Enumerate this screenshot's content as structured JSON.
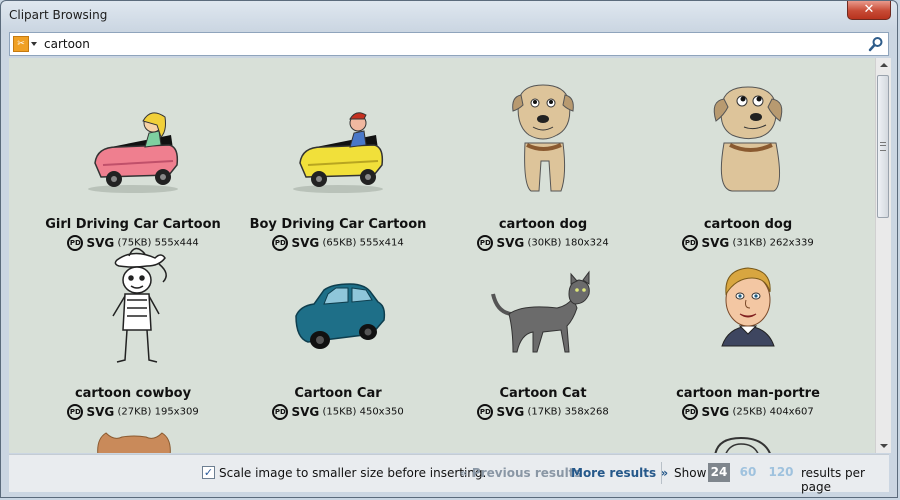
{
  "window": {
    "title": "Clipart Browsing",
    "close_glyph": "✕"
  },
  "search": {
    "query": "cartoon",
    "provider_icon": "openclipart-icon",
    "search_icon": "magnifier-icon"
  },
  "items": [
    {
      "title": "Girl Driving Car Cartoon",
      "license": "PD",
      "format": "SVG",
      "filesize": "(75KB)",
      "dimensions": "555x444"
    },
    {
      "title": "Boy Driving Car Cartoon",
      "license": "PD",
      "format": "SVG",
      "filesize": "(65KB)",
      "dimensions": "555x414"
    },
    {
      "title": "cartoon dog",
      "license": "PD",
      "format": "SVG",
      "filesize": "(30KB)",
      "dimensions": "180x324"
    },
    {
      "title": "cartoon dog",
      "license": "PD",
      "format": "SVG",
      "filesize": "(31KB)",
      "dimensions": "262x339"
    },
    {
      "title": "cartoon cowboy",
      "license": "PD",
      "format": "SVG",
      "filesize": "(27KB)",
      "dimensions": "195x309"
    },
    {
      "title": "Cartoon Car",
      "license": "PD",
      "format": "SVG",
      "filesize": "(15KB)",
      "dimensions": "450x350"
    },
    {
      "title": "Cartoon Cat",
      "license": "PD",
      "format": "SVG",
      "filesize": "(17KB)",
      "dimensions": "358x268"
    },
    {
      "title": "cartoon man-portre",
      "license": "PD",
      "format": "SVG",
      "filesize": "(25KB)",
      "dimensions": "404x607"
    }
  ],
  "footer": {
    "scale_checked": true,
    "check_glyph": "✓",
    "scale_label": "Scale image to smaller size before inserting.",
    "prev_label": "« Previous results",
    "more_label": "More results »",
    "show_label": "Show",
    "per_page_options": [
      "24",
      "60",
      "120"
    ],
    "per_page_selected": "24",
    "per_page_suffix": "results per page"
  },
  "colors": {
    "content_bg": "#d8e0d8",
    "link": "#25588a",
    "disabled": "#8a97a5",
    "selected_option": "#7f868d"
  }
}
